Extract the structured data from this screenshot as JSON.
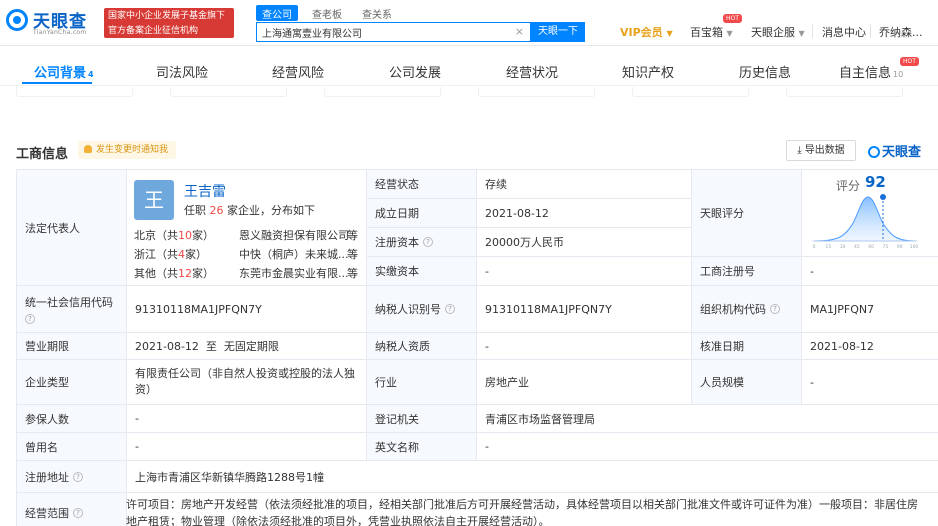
{
  "header": {
    "logo_text": "天眼查",
    "logo_sub": "TianYanCha.com",
    "gov_line1": "国家中小企业发展子基金旗下",
    "gov_line2": "官方备案企业征信机构",
    "search_tabs": [
      "查公司",
      "查老板",
      "查关系"
    ],
    "search_value": "上海通寓壹业有限公司",
    "search_button": "天眼一下",
    "vip": "VIP会员",
    "nav": [
      "百宝箱",
      "天眼企服",
      "消息中心",
      "乔纳森..."
    ],
    "hot_badge": "HOT"
  },
  "tabs": [
    {
      "label": "公司背景",
      "count": "4"
    },
    {
      "label": "司法风险",
      "count": ""
    },
    {
      "label": "经营风险",
      "count": ""
    },
    {
      "label": "公司发展",
      "count": ""
    },
    {
      "label": "经营状况",
      "count": ""
    },
    {
      "label": "知识产权",
      "count": ""
    },
    {
      "label": "历史信息",
      "count": ""
    },
    {
      "label": "自主信息",
      "count": "10"
    }
  ],
  "section": {
    "title": "工商信息",
    "notify": "发生变更时通知我",
    "export": "导出数据",
    "brand": "天眼查"
  },
  "legal": {
    "label": "法定代表人",
    "avatar_char": "王",
    "name": "王吉雷",
    "sub_prefix": "任职",
    "sub_count": "26",
    "sub_suffix": "家企业，分布如下",
    "rows": [
      {
        "region": "北京",
        "pre": "（共",
        "n": "10",
        "post": "家）",
        "org": "恩义融资担保有限公司",
        "tail": "等"
      },
      {
        "region": "浙江",
        "pre": "（共",
        "n": "4",
        "post": "家）",
        "org": "中快（桐庐）未来城...",
        "tail": "等"
      },
      {
        "region": "其他",
        "pre": "（共",
        "n": "12",
        "post": "家）",
        "org": "东莞市金晨实业有限...",
        "tail": "等"
      }
    ]
  },
  "fields": {
    "status_label": "经营状态",
    "status": "存续",
    "est_label": "成立日期",
    "est": "2021-08-12",
    "capital_label": "注册资本",
    "capital": "20000万人民币",
    "paid_label": "实缴资本",
    "paid": "-",
    "score_label": "天眼评分",
    "score_prefix": "评分",
    "score": "92",
    "regno_label": "工商注册号",
    "regno": "-",
    "credit_label": "统一社会信用代码",
    "credit": "91310118MA1JPFQN7Y",
    "taxid_label": "纳税人识别号",
    "taxid": "91310118MA1JPFQN7Y",
    "orgcode_label": "组织机构代码",
    "orgcode": "MA1JPFQN7",
    "term_label": "营业期限",
    "term": "2021-08-12  至  无固定期限",
    "taxq_label": "纳税人资质",
    "taxq": "-",
    "approve_label": "核准日期",
    "approve": "2021-08-12",
    "type_label": "企业类型",
    "type": "有限责任公司（非自然人投资或控股的法人独资）",
    "industry_label": "行业",
    "industry": "房地产业",
    "staff_label": "人员规模",
    "staff": "-",
    "insured_label": "参保人数",
    "insured": "-",
    "authority_label": "登记机关",
    "authority": "青浦区市场监督管理局",
    "formername_label": "曾用名",
    "formername": "-",
    "english_label": "英文名称",
    "english": "-",
    "address_label": "注册地址",
    "address": "上海市青浦区华新镇华腾路1288号1幢",
    "scope_label": "经营范围",
    "scope": "许可项目：房地产开发经营（依法须经批准的项目，经相关部门批准后方可开展经营活动，具体经营项目以相关部门批准文件或许可证件为准）一般项目：非居住房地产租赁；物业管理（除依法须经批准的项目外，凭营业执照依法自主开展经营活动）。"
  },
  "score_axis": [
    "0",
    "15",
    "30",
    "45",
    "60",
    "75",
    "90",
    "100"
  ],
  "colors": {
    "primary": "#0084ff",
    "label_bg": "#f6f9fd",
    "hot": "#f24a4a",
    "vip": "#e8a21a"
  }
}
